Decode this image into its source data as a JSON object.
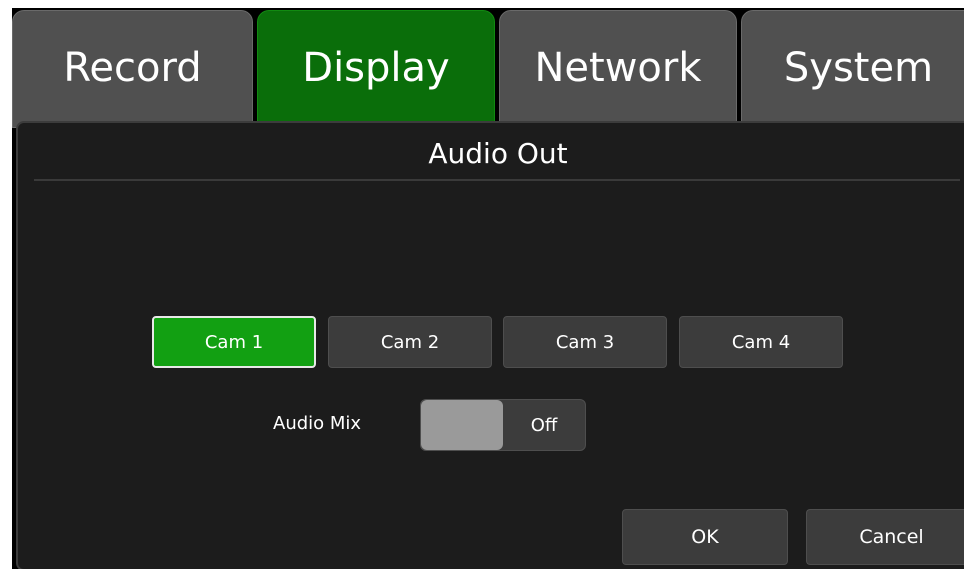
{
  "tabs": [
    {
      "label": "Record",
      "active": false
    },
    {
      "label": "Display",
      "active": true
    },
    {
      "label": "Network",
      "active": false
    },
    {
      "label": "System",
      "active": false
    }
  ],
  "panel": {
    "title": "Audio Out"
  },
  "cameras": [
    {
      "label": "Cam 1",
      "selected": true
    },
    {
      "label": "Cam 2",
      "selected": false
    },
    {
      "label": "Cam 3",
      "selected": false
    },
    {
      "label": "Cam 4",
      "selected": false
    }
  ],
  "audio_mix": {
    "label": "Audio Mix",
    "state": "Off"
  },
  "actions": {
    "ok_label": "OK",
    "cancel_label": "Cancel"
  },
  "colors": {
    "active_tab": "#0a6e0a",
    "selected_button": "#12a012",
    "inactive": "#505050",
    "panel_bg": "#1c1c1c"
  }
}
